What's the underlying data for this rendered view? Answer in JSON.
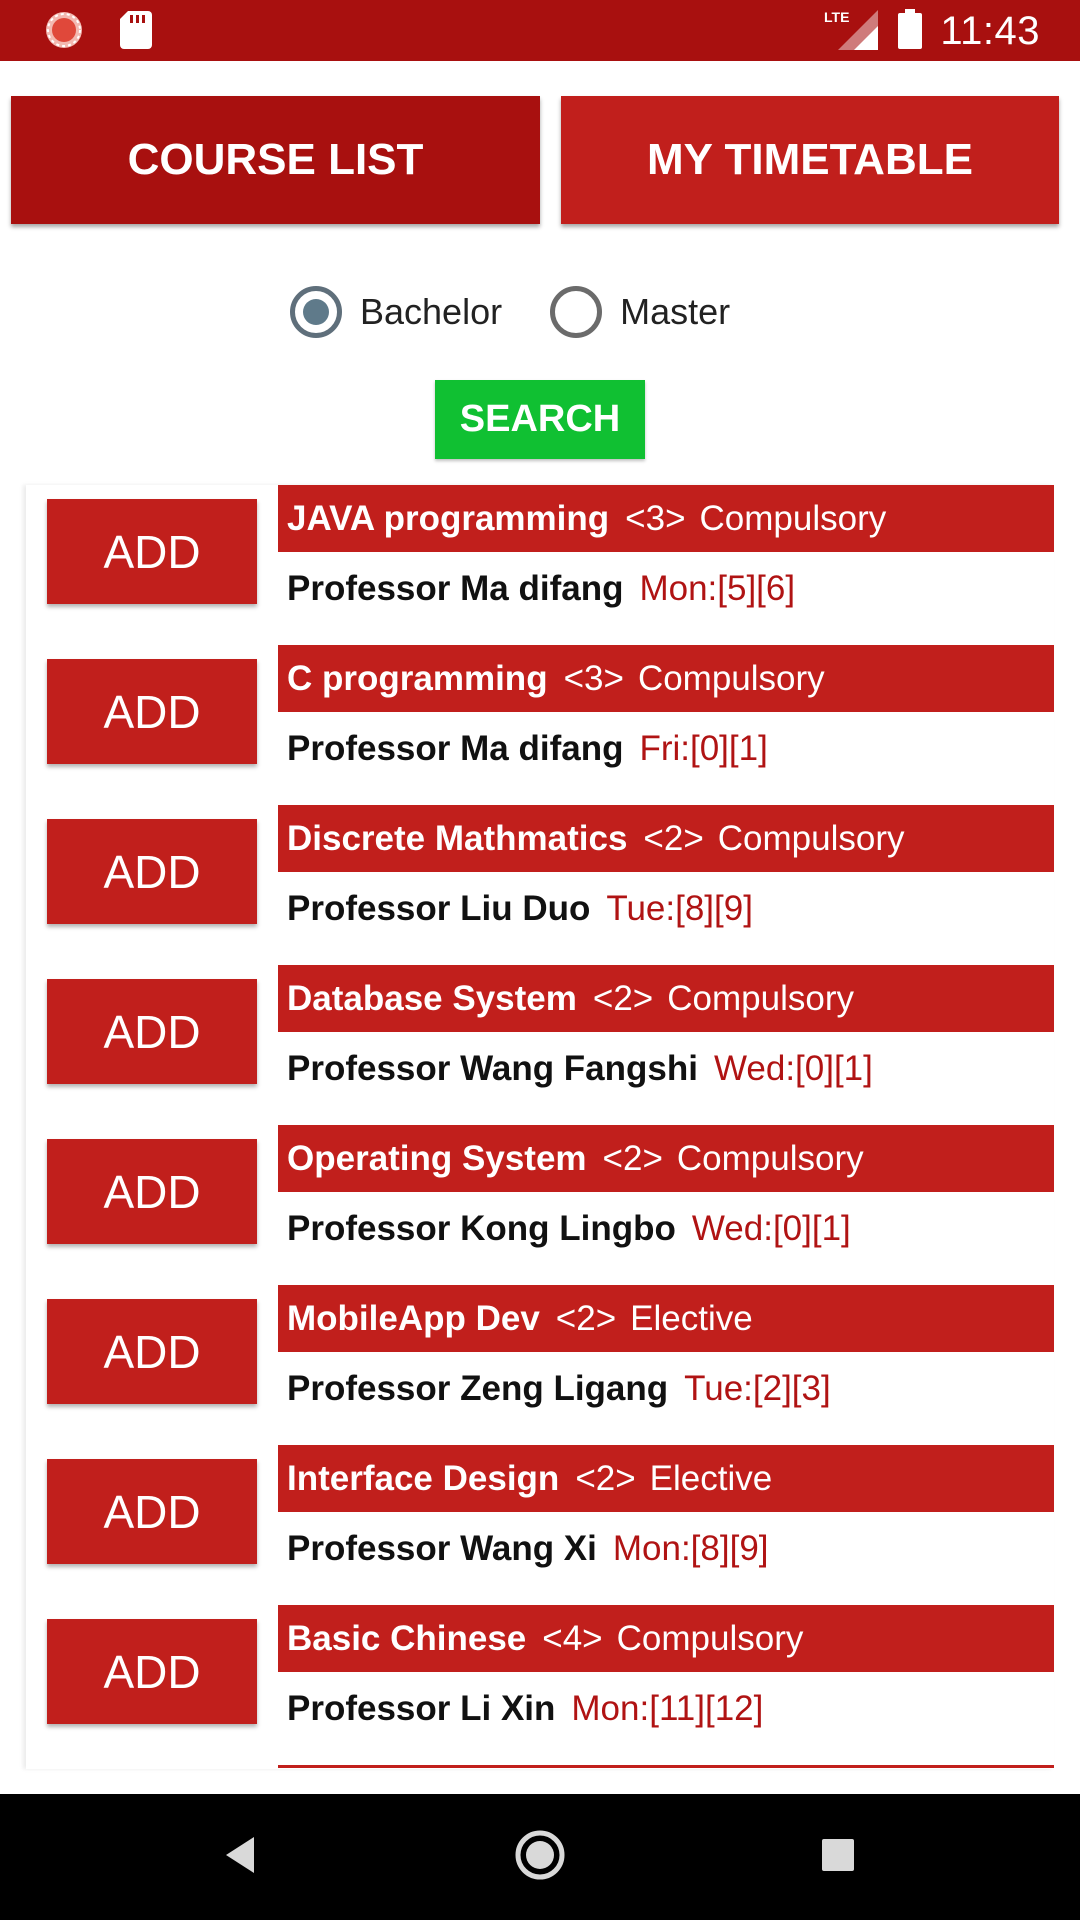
{
  "status_bar": {
    "time": "11:43",
    "network": "LTE",
    "icons": [
      "app-notification-icon",
      "sd-card-icon",
      "signal-icon",
      "battery-icon"
    ]
  },
  "tabs": {
    "course_list": "COURSE LIST",
    "my_timetable": "MY TIMETABLE"
  },
  "degree_filter": {
    "options": [
      "Bachelor",
      "Master"
    ],
    "selected": "Bachelor"
  },
  "search_label": "SEARCH",
  "add_label": "ADD",
  "courses": [
    {
      "name": "JAVA programming",
      "credit": "<3>",
      "type": "Compulsory",
      "professor": "Professor Ma difang",
      "time": "Mon:[5][6]"
    },
    {
      "name": "C programming",
      "credit": "<3>",
      "type": "Compulsory",
      "professor": "Professor Ma difang",
      "time": "Fri:[0][1]"
    },
    {
      "name": "Discrete Mathmatics",
      "credit": "<2>",
      "type": "Compulsory",
      "professor": "Professor Liu Duo",
      "time": "Tue:[8][9]"
    },
    {
      "name": "Database System",
      "credit": "<2>",
      "type": "Compulsory",
      "professor": "Professor Wang Fangshi",
      "time": "Wed:[0][1]"
    },
    {
      "name": "Operating System",
      "credit": "<2>",
      "type": "Compulsory",
      "professor": "Professor Kong Lingbo",
      "time": "Wed:[0][1]"
    },
    {
      "name": "MobileApp Dev",
      "credit": "<2>",
      "type": "Elective",
      "professor": "Professor Zeng Ligang",
      "time": "Tue:[2][3]"
    },
    {
      "name": "Interface Design",
      "credit": "<2>",
      "type": "Elective",
      "professor": "Professor Wang Xi",
      "time": "Mon:[8][9]"
    },
    {
      "name": "Basic Chinese",
      "credit": "<4>",
      "type": "Compulsory",
      "professor": "Professor Li Xin",
      "time": "Mon:[11][12]"
    }
  ],
  "colors": {
    "status_bar": "#a8100f",
    "primary_red": "#c11f1c",
    "dark_red": "#a8100f",
    "search_green": "#10c032",
    "time_text": "#b01313"
  },
  "nav_bar": {
    "icons": [
      "back-icon",
      "home-icon",
      "recents-icon"
    ]
  }
}
